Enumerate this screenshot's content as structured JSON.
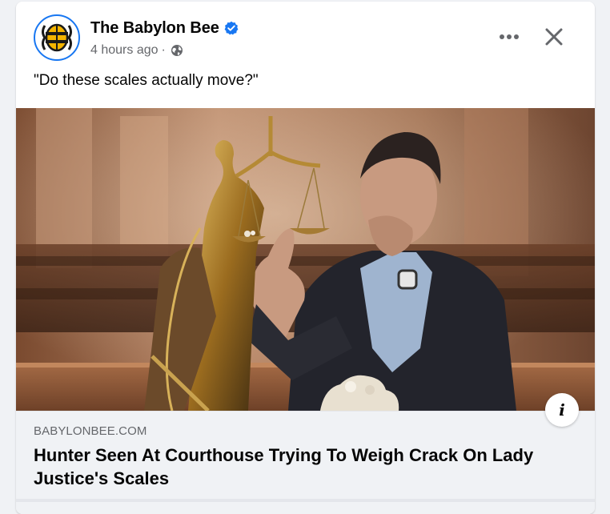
{
  "post": {
    "page_name": "The Babylon Bee",
    "verified_icon": "verified-badge-icon",
    "timestamp": "4 hours ago",
    "separator": "·",
    "audience_icon": "globe-icon",
    "caption": "\"Do these scales actually move?\""
  },
  "actions": {
    "more_icon": "more-options-icon",
    "close_icon": "close-icon"
  },
  "link_preview": {
    "domain": "BABYLONBEE.COM",
    "title": "Hunter Seen At Courthouse Trying To Weigh Crack On Lady Justice's Scales",
    "info_label": "i"
  },
  "colors": {
    "brand_blue": "#1877f2",
    "text_primary": "#050505",
    "text_secondary": "#65676b",
    "preview_bg": "#f0f2f5",
    "bee_yellow": "#f4b400"
  }
}
